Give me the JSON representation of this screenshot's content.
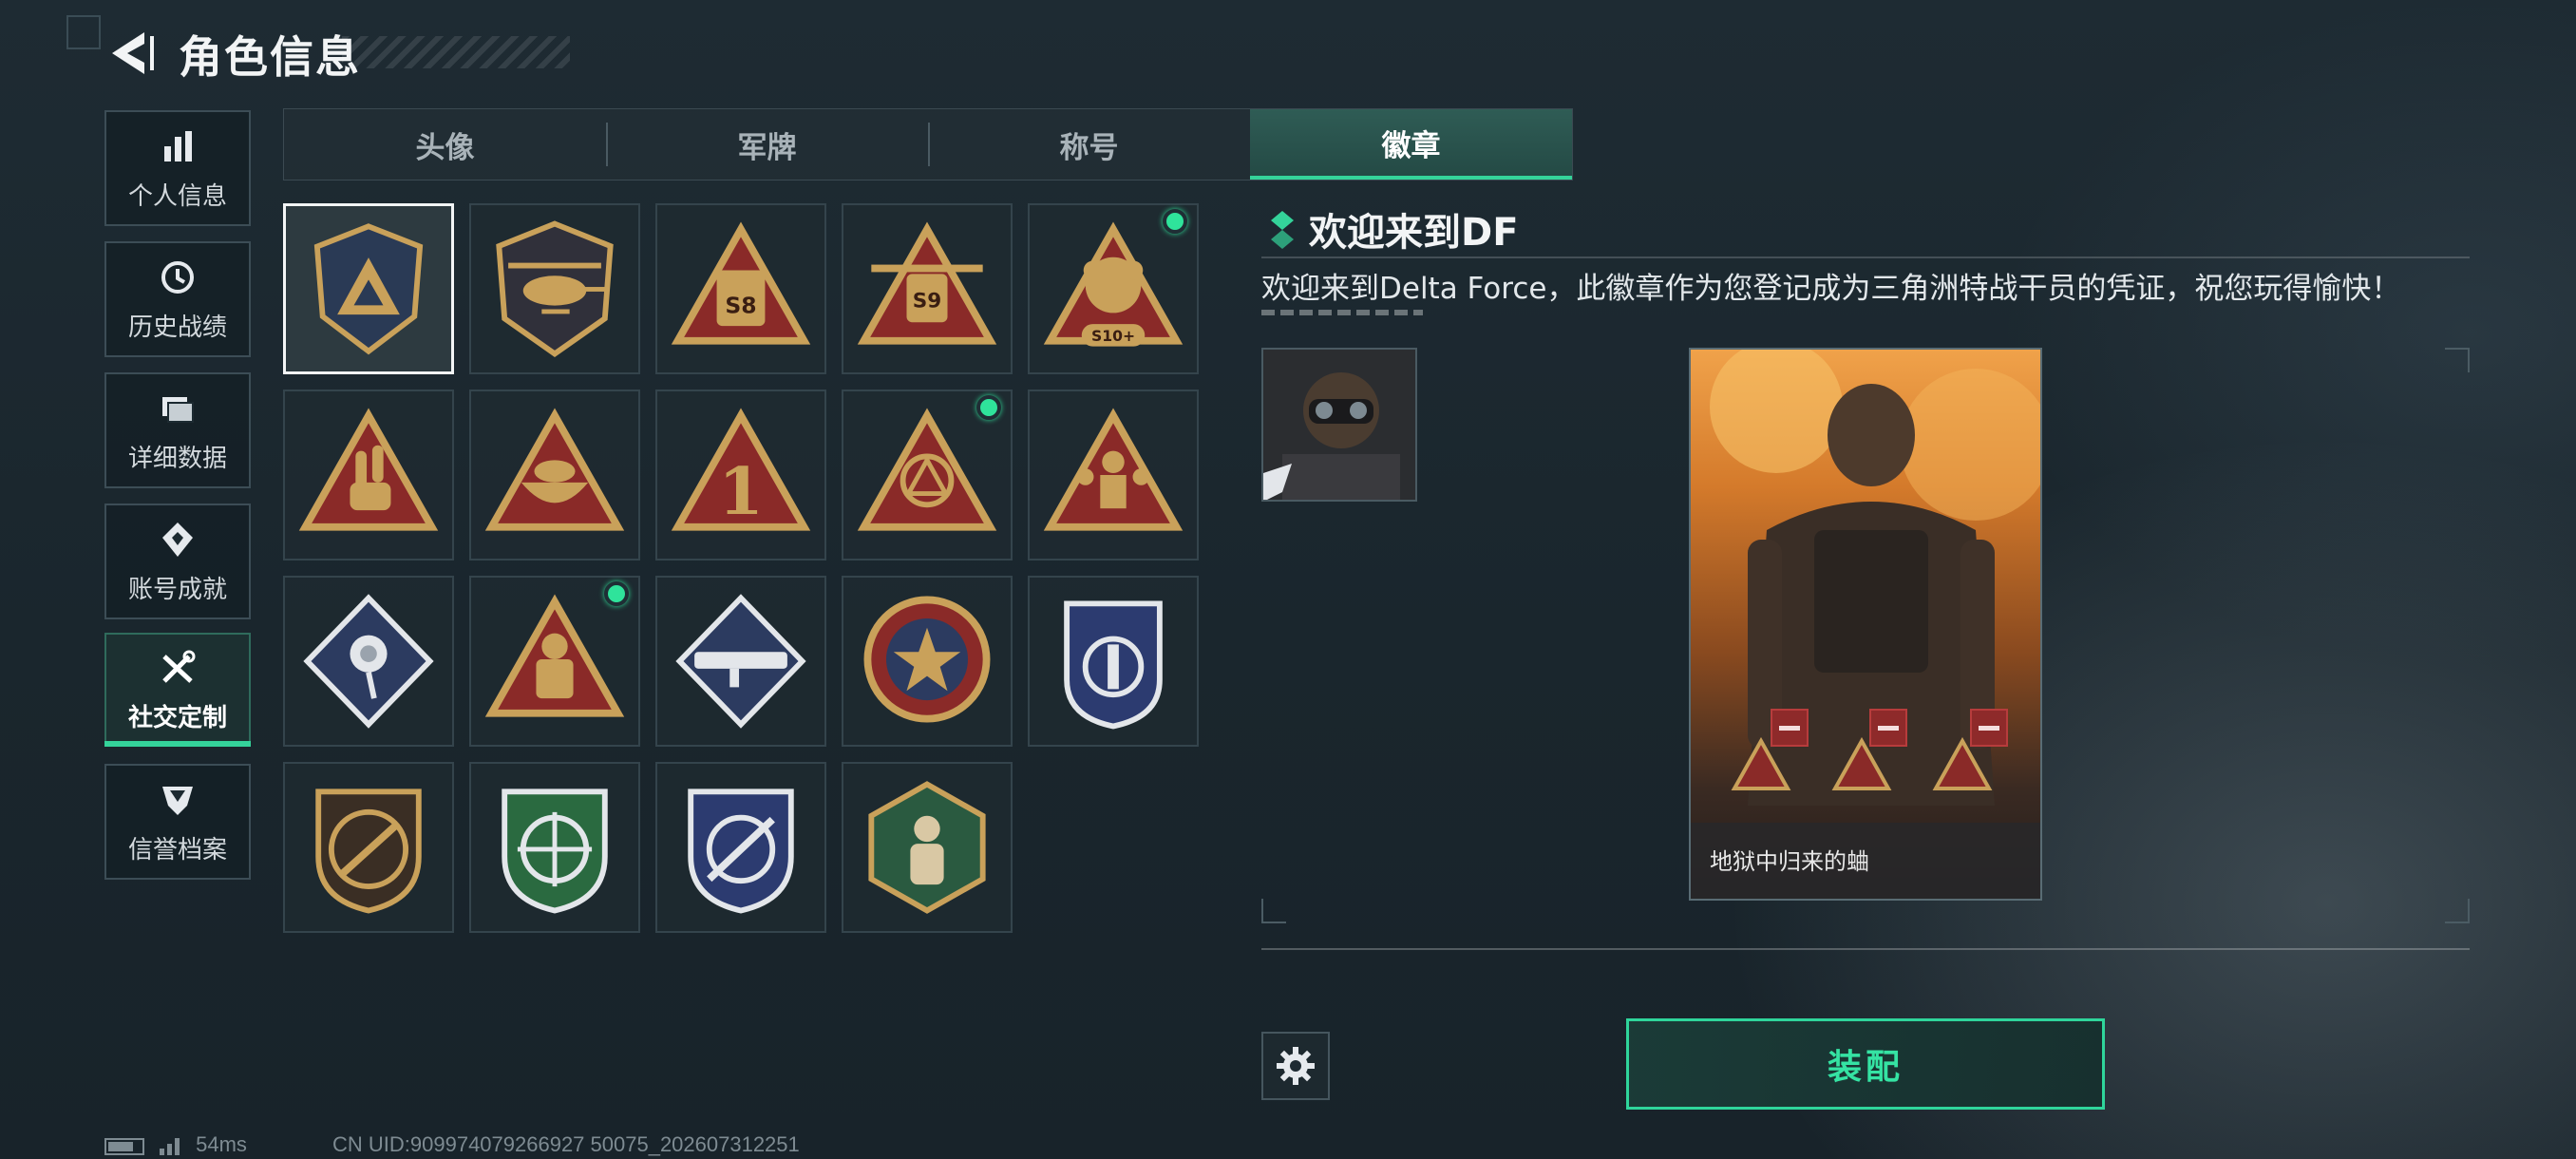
{
  "header": {
    "title": "角色信息",
    "back_icon": "back-arrow-icon"
  },
  "sidebar": {
    "items": [
      {
        "label": "个人信息",
        "icon": "bar-chart-icon"
      },
      {
        "label": "历史战绩",
        "icon": "history-clock-icon"
      },
      {
        "label": "详细数据",
        "icon": "folder-icon"
      },
      {
        "label": "账号成就",
        "icon": "achievement-icon"
      },
      {
        "label": "社交定制",
        "icon": "wrench-screwdriver-icon",
        "active": true
      },
      {
        "label": "信誉档案",
        "icon": "shield-emblem-icon"
      }
    ]
  },
  "tabs": [
    {
      "label": "头像"
    },
    {
      "label": "军牌"
    },
    {
      "label": "称号"
    },
    {
      "label": "徽章",
      "active": true
    }
  ],
  "badges": [
    {
      "name": "delta-badge",
      "selected": true
    },
    {
      "name": "helicopter-badge"
    },
    {
      "name": "s8-badge"
    },
    {
      "name": "s9-badge"
    },
    {
      "name": "s10-badge",
      "label": "S10+",
      "new": true
    },
    {
      "name": "hand-sign-badge"
    },
    {
      "name": "bowl-badge"
    },
    {
      "name": "number-one-badge"
    },
    {
      "name": "ritual-badge",
      "new": true
    },
    {
      "name": "squad-badge"
    },
    {
      "name": "rose-badge"
    },
    {
      "name": "operator-badge",
      "new": true
    },
    {
      "name": "launcher-badge"
    },
    {
      "name": "star-medal-badge"
    },
    {
      "name": "blue-shield-badge"
    },
    {
      "name": "rifle-badge"
    },
    {
      "name": "green-crosshair-badge"
    },
    {
      "name": "blue-crosshair-badge"
    },
    {
      "name": "hex-figure-badge"
    }
  ],
  "detail": {
    "title": "欢迎来到DF",
    "description": "欢迎来到Delta Force，此徽章作为您登记成为三角洲特战干员的凭证，祝您玩得愉快！",
    "card_caption": "地狱中归来的蛐"
  },
  "actions": {
    "equip_label": "装配"
  },
  "status_bar": {
    "ping": "54ms",
    "uid": "CN UID:909974079266927 50075_202607312251"
  },
  "colors": {
    "accent": "#34d39a",
    "badge_gold": "#c9a15a",
    "badge_red": "#8a2a28"
  }
}
